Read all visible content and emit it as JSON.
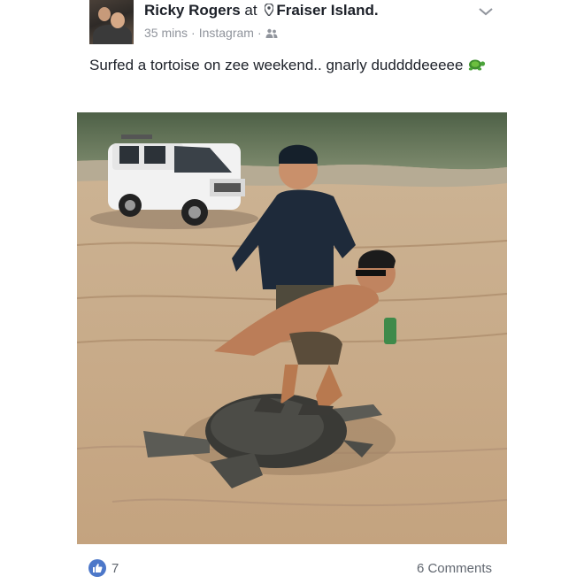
{
  "post": {
    "author": "Ricky Rogers",
    "at_word": "at",
    "location": "Fraiser Island.",
    "time": "35 mins",
    "separator": "·",
    "source": "Instagram",
    "audience_icon": "friends-icon",
    "message": "Surfed a tortoise on zee weekend.. gnarly duddddeeeee",
    "emoji": "turtle-icon",
    "photo_description_icon": "photo",
    "likes": "7",
    "comments": "6 Comments"
  },
  "colors": {
    "text": "#1d2129",
    "secondary": "#90949c",
    "like_blue": "#4c77c9"
  }
}
